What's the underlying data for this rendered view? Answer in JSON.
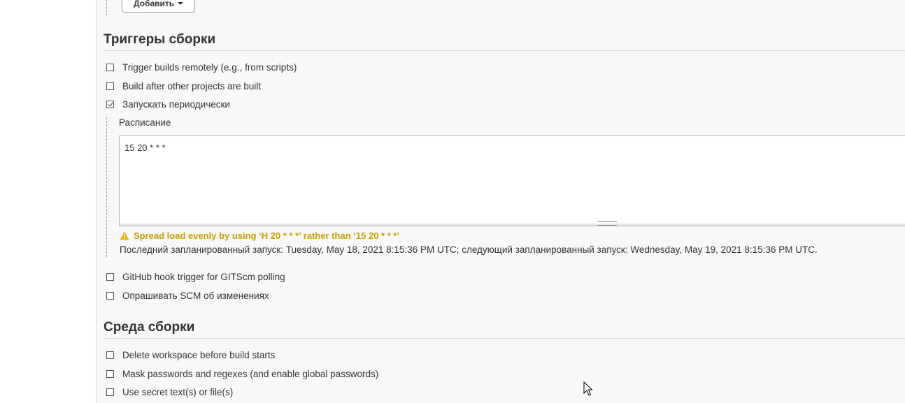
{
  "toolbar": {
    "add_label": "Добавить"
  },
  "triggers": {
    "title": "Триггеры сборки",
    "options": [
      {
        "label": "Trigger builds remotely (e.g., from scripts)",
        "checked": false
      },
      {
        "label": "Build after other projects are built",
        "checked": false
      },
      {
        "label": "Запускать периодически",
        "checked": true
      },
      {
        "label": "GitHub hook trigger for GITScm polling",
        "checked": false
      },
      {
        "label": "Опрашивать SCM об изменениях",
        "checked": false
      }
    ],
    "schedule": {
      "label": "Расписание",
      "value": "15 20 * * *",
      "warning": "Spread load evenly by using ‘H 20 * * *’ rather than ‘15 20 * * *’",
      "info": "Последний запланированный запуск: Tuesday, May 18, 2021 8:15:36 PM UTC; следующий запланированный запуск: Wednesday, May 19, 2021 8:15:36 PM UTC."
    }
  },
  "environment": {
    "title": "Среда сборки",
    "options": [
      {
        "label": "Delete workspace before build starts",
        "checked": false
      },
      {
        "label": "Mask passwords and regexes (and enable global passwords)",
        "checked": false
      },
      {
        "label": "Use secret text(s) or file(s)",
        "checked": false
      }
    ]
  },
  "colors": {
    "warning": "#c5a100",
    "background": "#f8f8f8"
  },
  "icons": {
    "warning": "warning-icon",
    "checkbox": "checkbox",
    "cursor": "mouse-cursor-icon"
  }
}
